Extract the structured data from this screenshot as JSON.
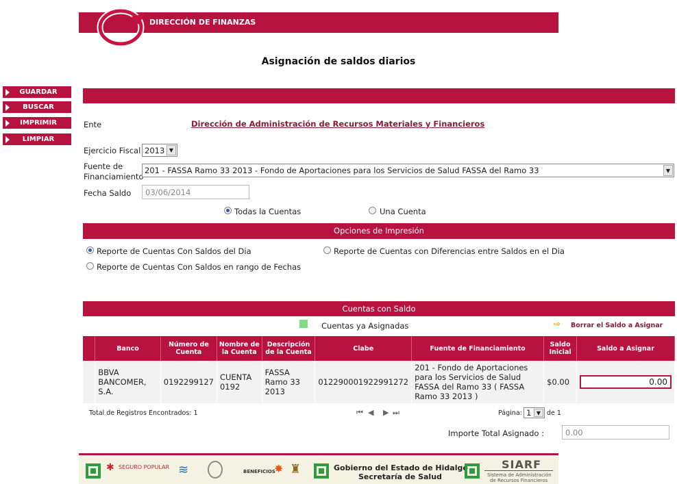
{
  "header": {
    "title": "DIRECCIÓN DE FINANZAS"
  },
  "page_title": "Asignación de saldos diarios",
  "menu": [
    {
      "label": "GUARDAR"
    },
    {
      "label": "BUSCAR"
    },
    {
      "label": "IMPRIMIR"
    },
    {
      "label": "LIMPIAR"
    }
  ],
  "form": {
    "ente_label": "Ente",
    "ente_value": "Dirección de Administración de Recursos Materiales y Financieros",
    "ejercicio_label": "Ejercicio Fiscal",
    "ejercicio_value": "2013",
    "fuente_label_1": "Fuente de",
    "fuente_label_2": "Financiamiento",
    "fuente_value": "201 - FASSA Ramo 33 2013 - Fondo de Aportaciones para los Servicios de Salud FASSA del Ramo 33",
    "fecha_label": "Fecha Saldo",
    "fecha_value": "03/06/2014",
    "radio_todas": "Todas la Cuentas",
    "radio_una": "Una Cuenta"
  },
  "print_options": {
    "title": "Opciones de Impresión",
    "opt1": "Reporte de Cuentas Con Saldos del Dia",
    "opt2": "Reporte de Cuentas con Diferencias entre Saldos en el Dia",
    "opt3": "Reporte de Cuentas Con Saldos en rango de Fechas"
  },
  "cuentas": {
    "title": "Cuentas con Saldo",
    "legend": "Cuentas ya Asignadas",
    "legend_color": "#7fdc7f",
    "borrar_label": "Borrar el Saldo a Asignar",
    "columns": [
      "Banco",
      "Número de Cuenta",
      "Nombre de la Cuenta",
      "Descripción de la Cuenta",
      "Clabe",
      "Fuente de Financiamiento",
      "Saldo Inicial",
      "Saldo a Asignar"
    ],
    "row": {
      "banco": "BBVA BANCOMER, S.A.",
      "numero": "0192299127",
      "nombre": "CUENTA 0192",
      "descripcion": "FASSA Ramo 33 2013",
      "clabe": "012290001922991272",
      "fuente": "201 - Fondo de Aportaciones para los Servicios de Salud FASSA del Ramo 33 ( FASSA Ramo 33 2013 )",
      "saldo_inicial": "$0.00",
      "saldo_asignar": "0.00"
    },
    "total_registros": "Total de Registros Encontrados: 1",
    "pagina_label": "Página:",
    "pagina_value": "1",
    "pagina_de": "de 1",
    "importe_label": "Importe Total Asignado :",
    "importe_value": "0.00"
  },
  "footer": {
    "seguro_popular": "SEGURO POPULAR",
    "beneficios": "BENEFICIOS",
    "gobierno_1": "Gobierno del Estado de Hidalgo",
    "gobierno_2": "Secretaría de Salud",
    "siarf": "SIARF",
    "siarf_sub_1": "Sistema de Administración",
    "siarf_sub_2": "de Recursos Financieros"
  },
  "colors": {
    "brand": "#b8123f",
    "link": "#8b1a35"
  }
}
